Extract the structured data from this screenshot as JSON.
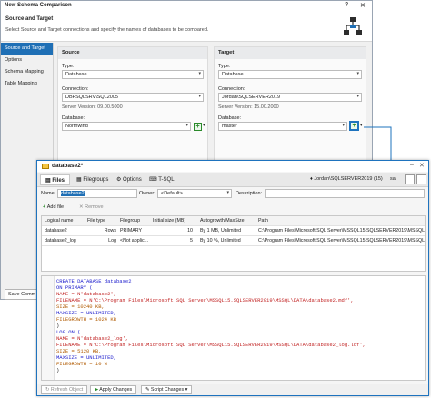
{
  "window": {
    "title": "New Schema Comparison"
  },
  "header": {
    "title": "Source and Target",
    "subtitle": "Select Source and Target connections and specify the names of databases to be compared."
  },
  "nav": {
    "items": [
      "Source and Target",
      "Options",
      "Schema Mapping",
      "Table Mapping"
    ]
  },
  "save_button": "Save Comm",
  "source": {
    "heading": "Source",
    "type_label": "Type:",
    "type_value": "Database",
    "connection_label": "Connection:",
    "connection_value": "DBFSQLSRV\\SQL2005",
    "server_version": "Server Version: 09.00.5000",
    "database_label": "Database:",
    "database_value": "Northwind"
  },
  "target": {
    "heading": "Target",
    "type_label": "Type:",
    "type_value": "Database",
    "connection_label": "Connection:",
    "connection_value": "Jordan\\SQLSERVER2019",
    "server_version": "Server Version: 15.00.2000",
    "database_label": "Database:",
    "database_value": "master"
  },
  "dialog": {
    "title": "database2*",
    "tabs": [
      "Files",
      "Filegroups",
      "Options",
      "T-SQL"
    ],
    "connection": "Jordan\\SQLSERVER2019 (15)",
    "user": "sa",
    "name_label": "Name:",
    "name_value": "database2",
    "owner_label": "Owner:",
    "owner_value": "<Default>",
    "description_label": "Description:",
    "add_file": "Add file",
    "remove": "Remove",
    "columns": [
      "Logical name",
      "File type",
      "Filegroup",
      "Initial size (MB)",
      "Autogrowth/MaxSize",
      "Path"
    ],
    "rows": [
      [
        "database2",
        "Rows",
        "PRIMARY",
        "10",
        "By 1 MB, Unlimited",
        "C:\\Program Files\\Microsoft SQL Server\\MSSQL15.SQLSERVER2019\\MSSQL\\DATA\\"
      ],
      [
        "database2_log",
        "Log",
        "<Not applic...",
        "5",
        "By 10 %, Unlimited",
        "C:\\Program Files\\Microsoft SQL Server\\MSSQL15.SQLSERVER2019\\MSSQL\\DATA\\"
      ]
    ],
    "sql": [
      "CREATE DATABASE database2",
      "ON PRIMARY (",
      "NAME = N'database2',",
      "FILENAME = N'C:\\Program Files\\Microsoft SQL Server\\MSSQL15.SQLSERVER2019\\MSSQL\\DATA\\database2.mdf',",
      "SIZE = 10240 KB,",
      "MAXSIZE = UNLIMITED,",
      "FILEGROWTH = 1024 KB",
      ")",
      "LOG ON (",
      "NAME = N'database2_log',",
      "FILENAME = N'C:\\Program Files\\Microsoft SQL Server\\MSSQL15.SQLSERVER2019\\MSSQL\\DATA\\database2_log.ldf',",
      "SIZE = 5120 KB,",
      "MAXSIZE = UNLIMITED,",
      "FILEGROWTH = 10 %",
      ")"
    ],
    "footer": {
      "refresh": "Refresh Object",
      "apply": "Apply Changes",
      "script": "Script Changes"
    }
  }
}
